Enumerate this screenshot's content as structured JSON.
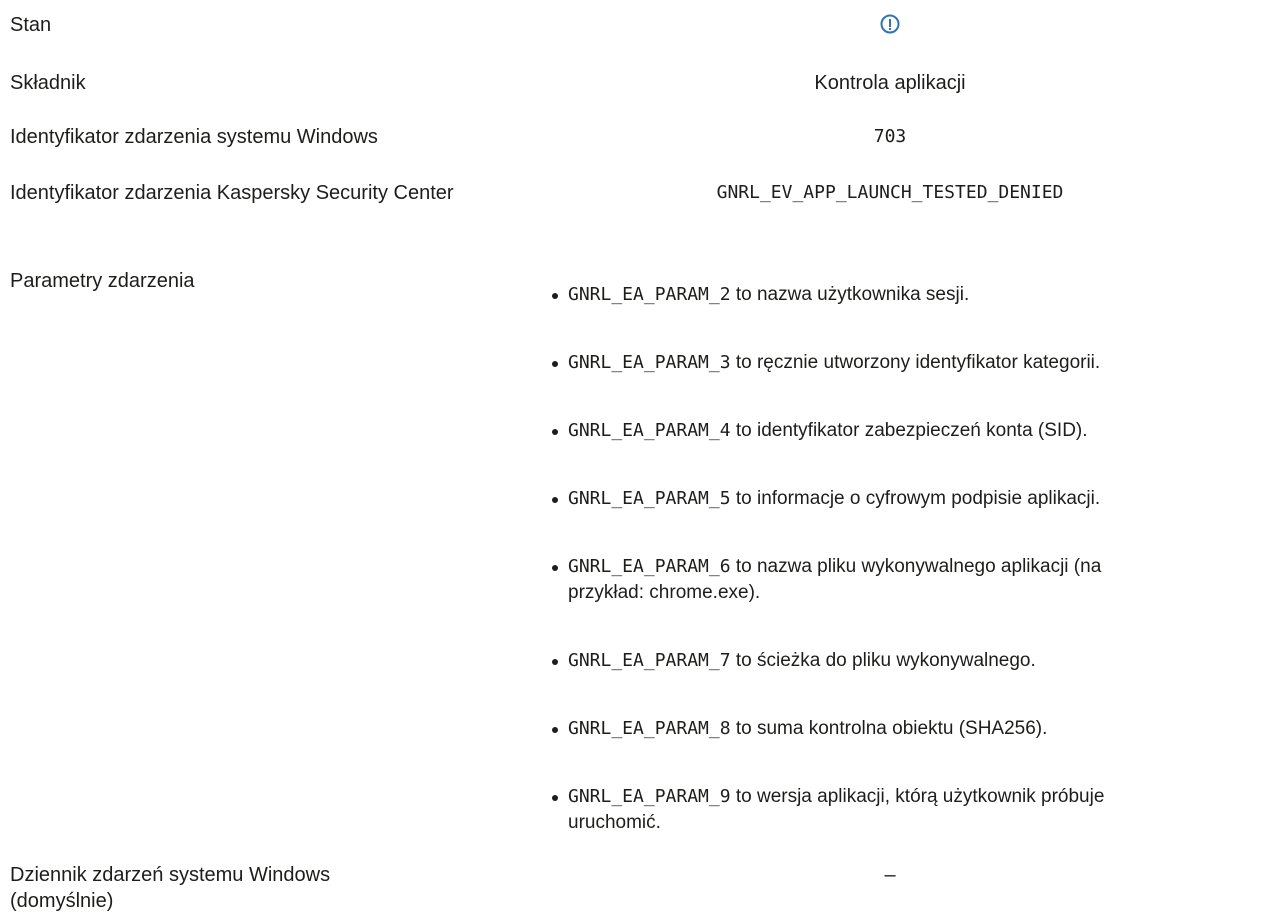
{
  "rows": {
    "status": {
      "label": "Stan"
    },
    "component": {
      "label": "Składnik",
      "value": "Kontrola aplikacji"
    },
    "windows_event_id": {
      "label": "Identyfikator zdarzenia systemu Windows",
      "value": "703"
    },
    "ksc_event_id": {
      "label": "Identyfikator zdarzenia Kaspersky Security Center",
      "value": "GNRL_EV_APP_LAUNCH_TESTED_DENIED"
    },
    "event_params": {
      "label": "Parametry zdarzenia"
    },
    "windows_log": {
      "label": "Dziennik zdarzeń systemu Windows (domyślnie)",
      "value": "–"
    }
  },
  "params": [
    {
      "code": "GNRL_EA_PARAM_2",
      "text": "to nazwa użytkownika sesji."
    },
    {
      "code": "GNRL_EA_PARAM_3",
      "text": "to ręcznie utworzony identyfikator kategorii."
    },
    {
      "code": "GNRL_EA_PARAM_4",
      "text": "to identyfikator zabezpieczeń konta (SID)."
    },
    {
      "code": "GNRL_EA_PARAM_5",
      "text": "to informacje o cyfrowym podpisie aplikacji."
    },
    {
      "code": "GNRL_EA_PARAM_6",
      "text": "to nazwa pliku wykonywalnego aplikacji (na przykład: chrome.exe)."
    },
    {
      "code": "GNRL_EA_PARAM_7",
      "text": "to ścieżka do pliku wykonywalnego."
    },
    {
      "code": "GNRL_EA_PARAM_8",
      "text": "to suma kontrolna obiektu (SHA256)."
    },
    {
      "code": "GNRL_EA_PARAM_9",
      "text": "to wersja aplikacji, którą użytkownik próbuje uruchomić."
    }
  ],
  "icons": {
    "status": "info-icon"
  },
  "colors": {
    "info_icon": "#2e74b5"
  }
}
